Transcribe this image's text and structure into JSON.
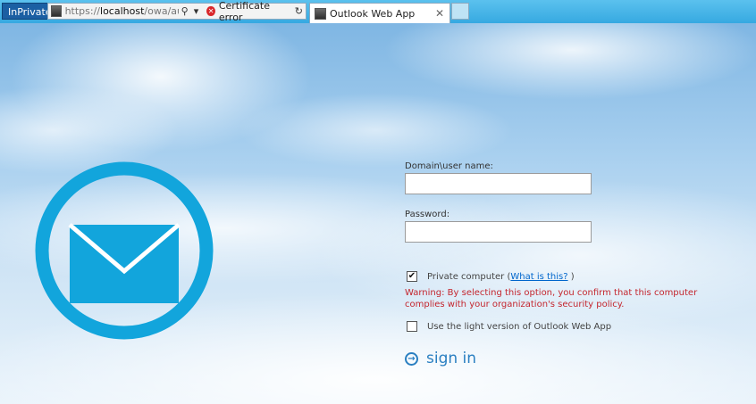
{
  "browser": {
    "inprivate_label": "InPrivate",
    "address_scheme": "https://",
    "address_host": "localhost",
    "address_path": "/owa/auth/logor",
    "search_glyph": "⚲",
    "dropdown_glyph": "▾",
    "cert_error_label": "Certificate error",
    "refresh_glyph": "↻",
    "tab_title": "Outlook Web App",
    "tab_close_glyph": "✕"
  },
  "form": {
    "username_label": "Domain\\user name:",
    "username_value": "",
    "password_label": "Password:",
    "password_value": "",
    "private_checked_glyph": "✔",
    "private_label": "Private computer",
    "private_paren_open": "(",
    "private_link": "What is this?",
    "private_paren_close": ")",
    "warning_text": "Warning: By selecting this option, you confirm that this computer complies with your organization's security policy.",
    "light_checked_glyph": "",
    "light_label": "Use the light version of Outlook Web App",
    "signin_glyph": "→",
    "signin_label": "sign in"
  },
  "colors": {
    "accent": "#2a7fc1",
    "logo": "#12a5dc",
    "warning": "#c4262e",
    "link": "#0066cc"
  },
  "icons": [
    "search-icon",
    "dropdown-icon",
    "certificate-error-icon",
    "refresh-icon",
    "close-icon",
    "mail-envelope-logo",
    "arrow-right-circle-icon"
  ]
}
